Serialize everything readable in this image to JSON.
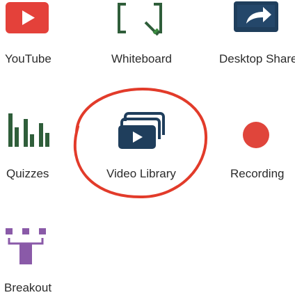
{
  "apps": [
    {
      "label": "YouTube",
      "icon": "youtube-icon"
    },
    {
      "label": "Whiteboard",
      "icon": "whiteboard-icon"
    },
    {
      "label": "Desktop Share",
      "icon": "desktop-share-icon"
    },
    {
      "label": "Quizzes",
      "icon": "quizzes-icon"
    },
    {
      "label": "Video Library",
      "icon": "video-library-icon"
    },
    {
      "label": "Recording",
      "icon": "recording-icon"
    },
    {
      "label": "Breakout",
      "icon": "breakout-icon"
    }
  ],
  "colors": {
    "youtube_red": "#e4413a",
    "whiteboard_green": "#2f5e3a",
    "accent_navy": "#1f3e5c",
    "recording_red": "#e0453b",
    "breakout_purple": "#8a5aa8",
    "highlight_circle": "#e23b2a"
  },
  "highlight": {
    "target": "Video Library",
    "shape": "hand-drawn circle"
  }
}
